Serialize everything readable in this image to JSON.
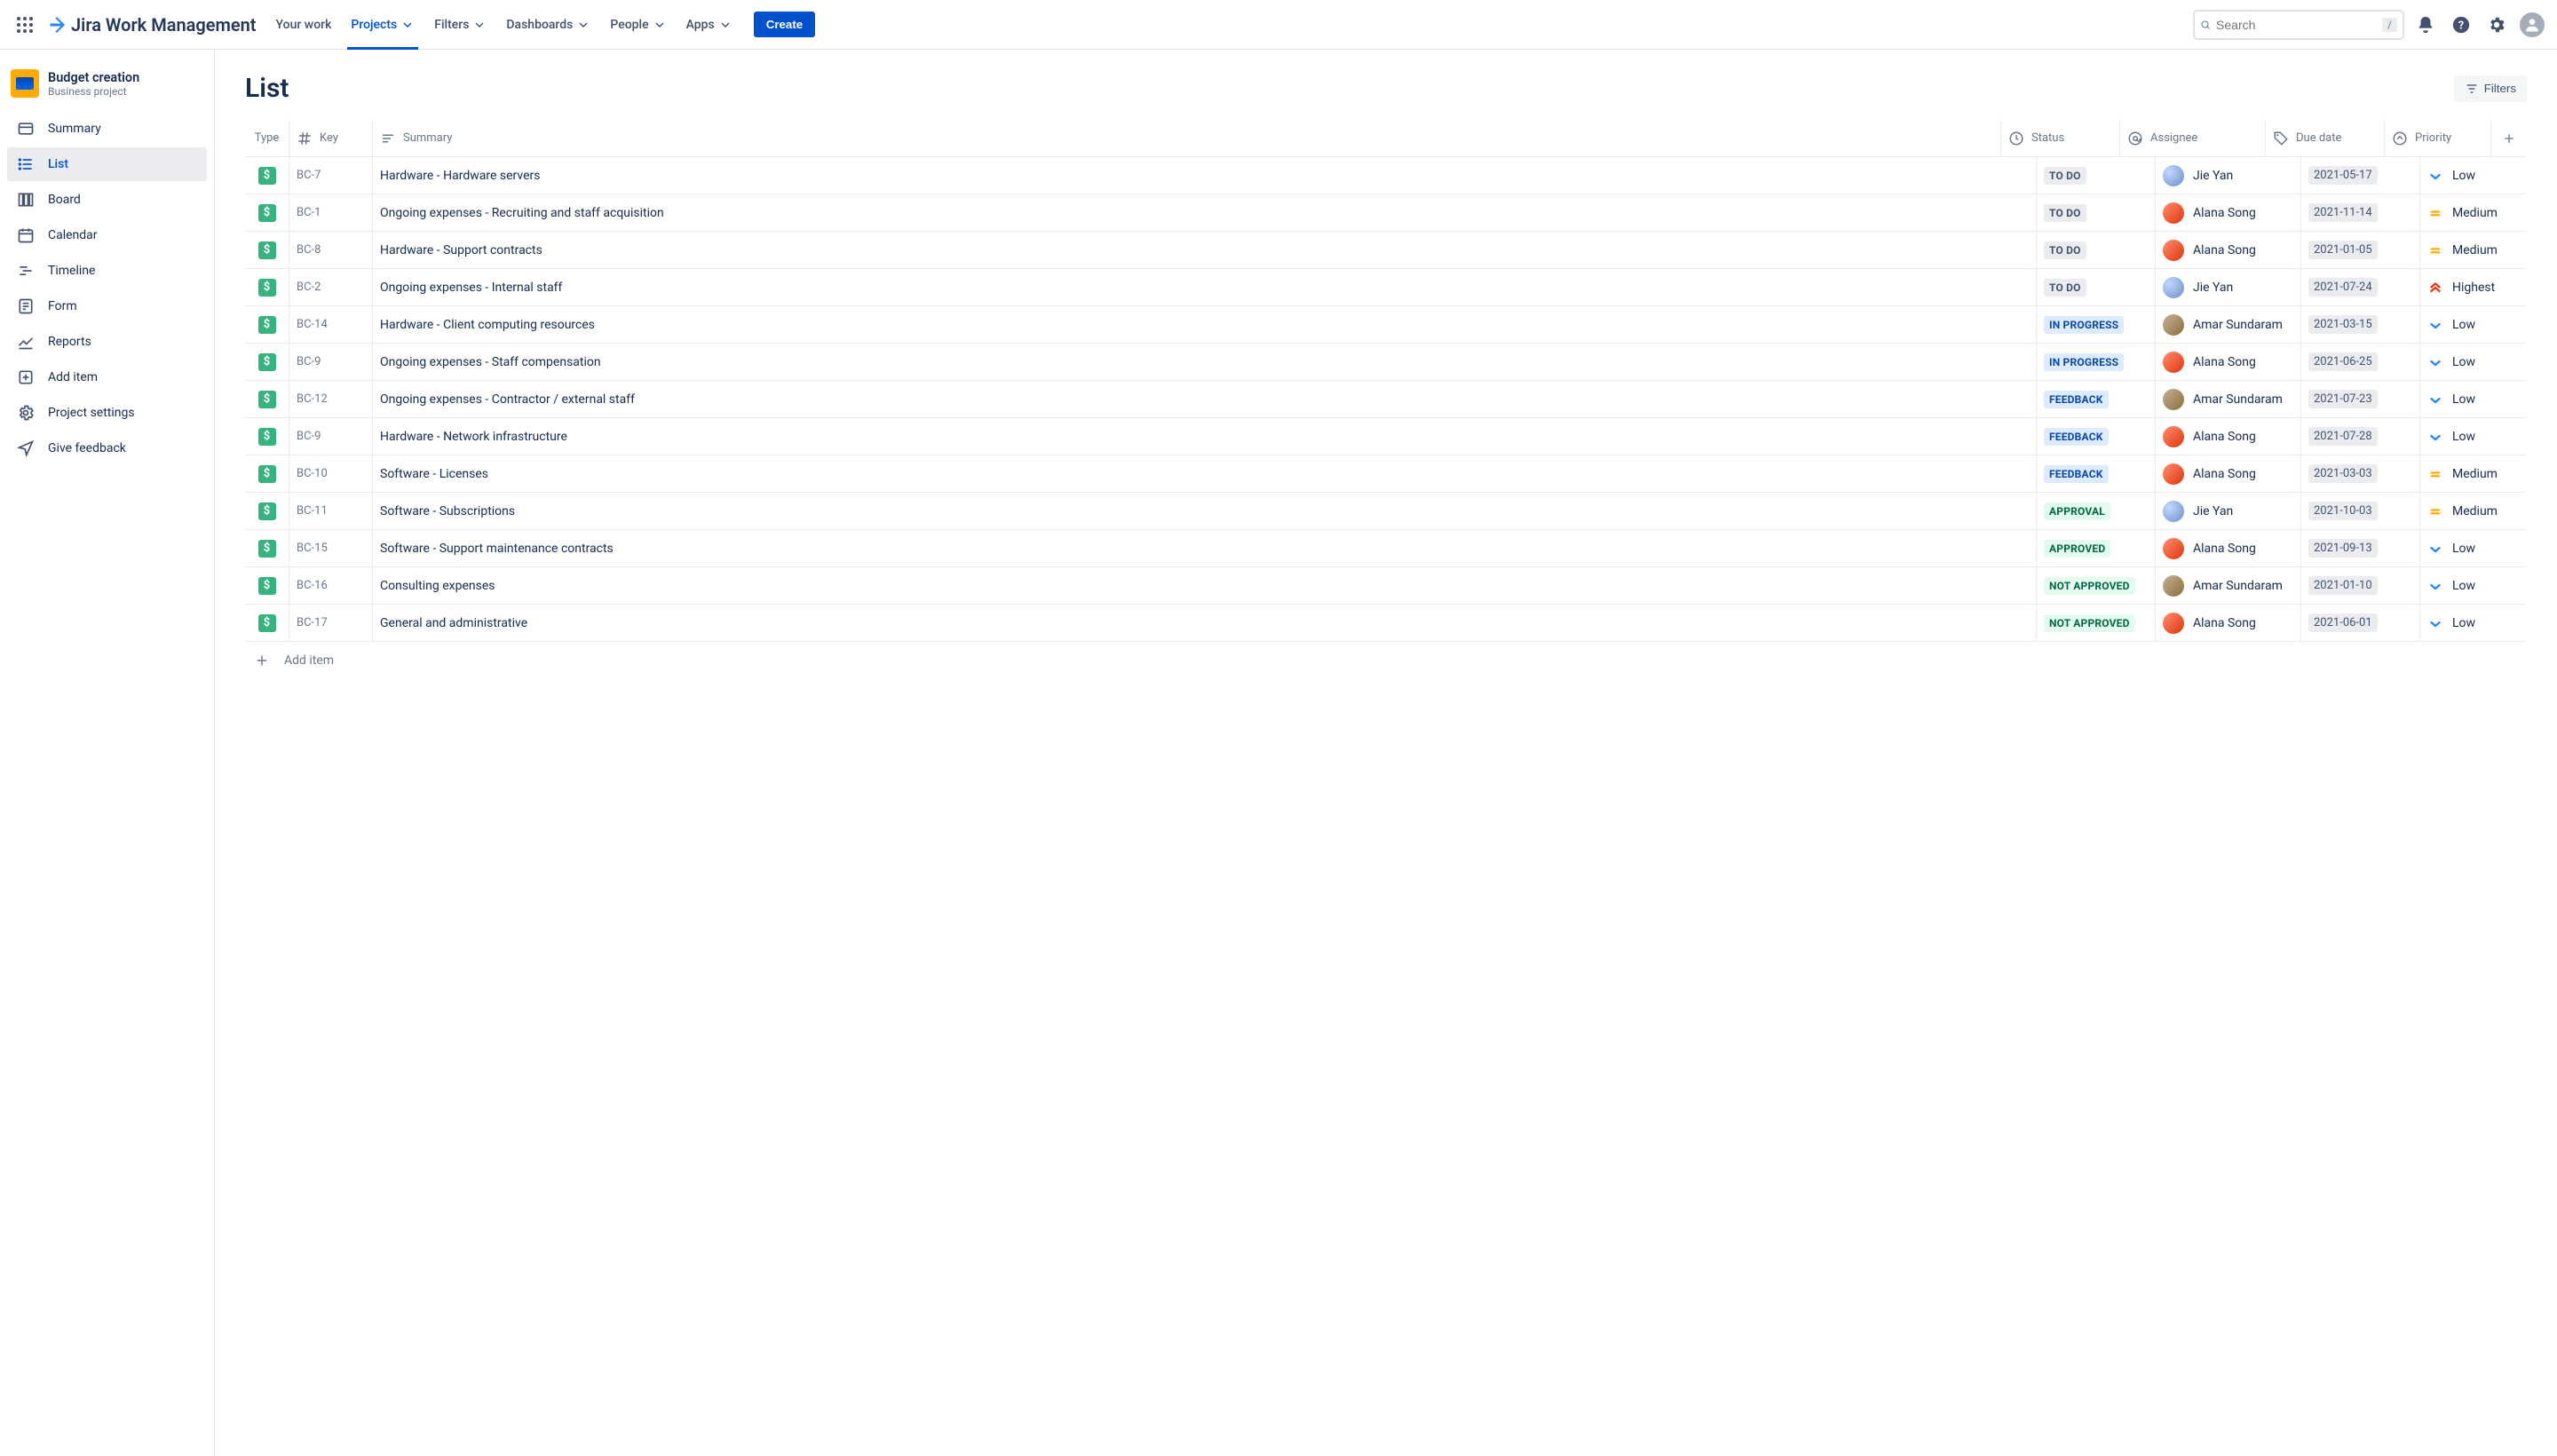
{
  "top": {
    "product_name": "Jira Work Management",
    "nav": [
      {
        "label": "Your work",
        "has_chev": false,
        "active": false
      },
      {
        "label": "Projects",
        "has_chev": true,
        "active": true
      },
      {
        "label": "Filters",
        "has_chev": true,
        "active": false
      },
      {
        "label": "Dashboards",
        "has_chev": true,
        "active": false
      },
      {
        "label": "People",
        "has_chev": true,
        "active": false
      },
      {
        "label": "Apps",
        "has_chev": true,
        "active": false
      }
    ],
    "create_label": "Create",
    "search_placeholder": "Search",
    "search_kbd": "/"
  },
  "sidebar": {
    "project_name": "Budget creation",
    "project_type": "Business project",
    "items": [
      {
        "label": "Summary",
        "icon": "summary-icon",
        "active": false
      },
      {
        "label": "List",
        "icon": "list-icon",
        "active": true
      },
      {
        "label": "Board",
        "icon": "board-icon",
        "active": false
      },
      {
        "label": "Calendar",
        "icon": "calendar-icon",
        "active": false
      },
      {
        "label": "Timeline",
        "icon": "timeline-icon",
        "active": false
      },
      {
        "label": "Form",
        "icon": "form-icon",
        "active": false
      },
      {
        "label": "Reports",
        "icon": "reports-icon",
        "active": false
      },
      {
        "label": "Add item",
        "icon": "add-item-icon",
        "active": false
      },
      {
        "label": "Project settings",
        "icon": "settings-icon",
        "active": false
      },
      {
        "label": "Give feedback",
        "icon": "feedback-icon",
        "active": false
      }
    ]
  },
  "page": {
    "title": "List",
    "filters_label": "Filters",
    "add_item_label": "Add item"
  },
  "columns": {
    "type": "Type",
    "key": "Key",
    "summary": "Summary",
    "status": "Status",
    "assignee": "Assignee",
    "due": "Due date",
    "priority": "Priority"
  },
  "status_classes": {
    "TO DO": "s-todo",
    "IN PROGRESS": "s-inprogress",
    "FEEDBACK": "s-feedback",
    "APPROVAL": "s-approval",
    "APPROVED": "s-approved",
    "NOT APPROVED": "s-notapproved"
  },
  "assignee_avatars": {
    "Jie Yan": "jie",
    "Alana Song": "alana",
    "Amar Sundaram": "amar"
  },
  "priority_colors": {
    "Low": "#2684FF",
    "Medium": "#FFAB00",
    "Highest": "#DE350B"
  },
  "rows": [
    {
      "key": "BC-7",
      "summary": "Hardware - Hardware servers",
      "status": "TO DO",
      "assignee": "Jie Yan",
      "due": "2021-05-17",
      "prio": "Low"
    },
    {
      "key": "BC-1",
      "summary": "Ongoing expenses - Recruiting and staff acquisition",
      "status": "TO DO",
      "assignee": "Alana Song",
      "due": "2021-11-14",
      "prio": "Medium"
    },
    {
      "key": "BC-8",
      "summary": "Hardware - Support contracts",
      "status": "TO DO",
      "assignee": "Alana Song",
      "due": "2021-01-05",
      "prio": "Medium"
    },
    {
      "key": "BC-2",
      "summary": "Ongoing expenses - Internal staff",
      "status": "TO DO",
      "assignee": "Jie Yan",
      "due": "2021-07-24",
      "prio": "Highest"
    },
    {
      "key": "BC-14",
      "summary": "Hardware - Client computing resources",
      "status": "IN PROGRESS",
      "assignee": "Amar Sundaram",
      "due": "2021-03-15",
      "prio": "Low"
    },
    {
      "key": "BC-9",
      "summary": "Ongoing expenses - Staff compensation",
      "status": "IN PROGRESS",
      "assignee": "Alana Song",
      "due": "2021-06-25",
      "prio": "Low"
    },
    {
      "key": "BC-12",
      "summary": "Ongoing expenses - Contractor / external staff",
      "status": "FEEDBACK",
      "assignee": "Amar Sundaram",
      "due": "2021-07-23",
      "prio": "Low"
    },
    {
      "key": "BC-9",
      "summary": "Hardware - Network infrastructure",
      "status": "FEEDBACK",
      "assignee": "Alana Song",
      "due": "2021-07-28",
      "prio": "Low"
    },
    {
      "key": "BC-10",
      "summary": "Software - Licenses",
      "status": "FEEDBACK",
      "assignee": "Alana Song",
      "due": "2021-03-03",
      "prio": "Medium"
    },
    {
      "key": "BC-11",
      "summary": "Software - Subscriptions",
      "status": "APPROVAL",
      "assignee": "Jie Yan",
      "due": "2021-10-03",
      "prio": "Medium"
    },
    {
      "key": "BC-15",
      "summary": "Software - Support maintenance contracts",
      "status": "APPROVED",
      "assignee": "Alana Song",
      "due": "2021-09-13",
      "prio": "Low"
    },
    {
      "key": "BC-16",
      "summary": "Consulting expenses",
      "status": "NOT APPROVED",
      "assignee": "Amar Sundaram",
      "due": "2021-01-10",
      "prio": "Low"
    },
    {
      "key": "BC-17",
      "summary": "General and administrative",
      "status": "NOT APPROVED",
      "assignee": "Alana Song",
      "due": "2021-06-01",
      "prio": "Low"
    }
  ]
}
